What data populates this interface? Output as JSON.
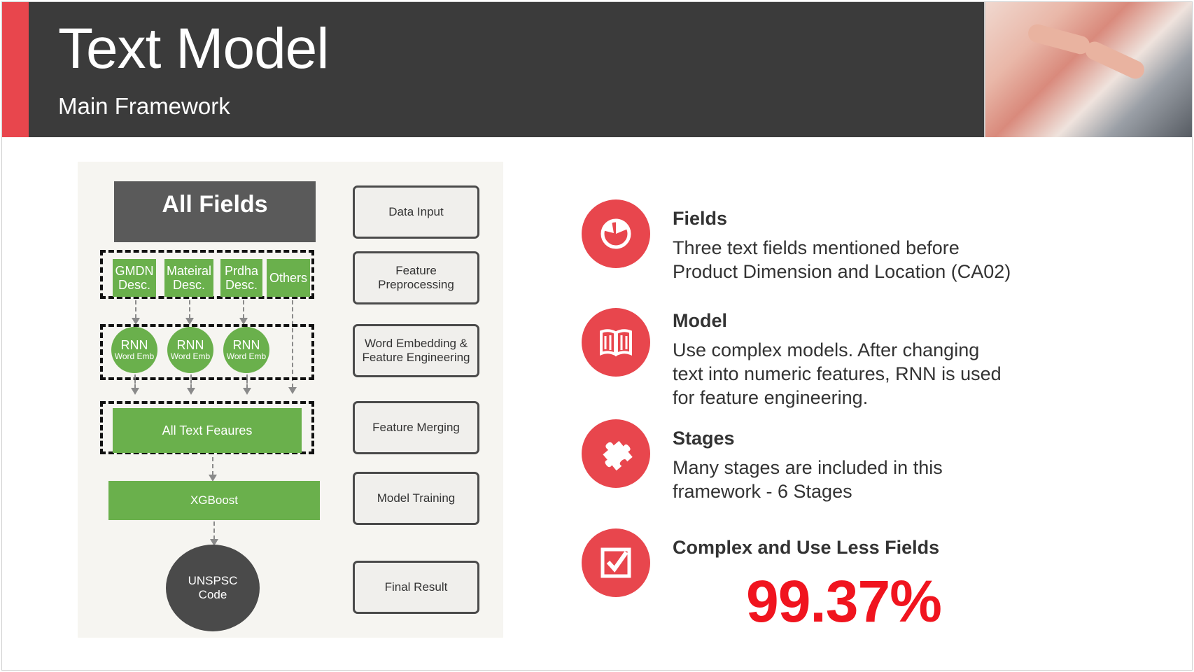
{
  "header": {
    "title": "Text Model",
    "subtitle": "Main Framework"
  },
  "diagram": {
    "all_fields": "All Fields",
    "inputs": [
      {
        "line1": "GMDN",
        "line2": "Desc."
      },
      {
        "line1": "Mateiral",
        "line2": "Desc."
      },
      {
        "line1": "Prdha",
        "line2": "Desc."
      },
      {
        "line1": "Others",
        "line2": ""
      }
    ],
    "rnn": [
      {
        "big": "RNN",
        "small": "Word Emb"
      },
      {
        "big": "RNN",
        "small": "Word Emb"
      },
      {
        "big": "RNN",
        "small": "Word Emb"
      }
    ],
    "all_text": "All Text Feaures",
    "xgboost": "XGBoost",
    "result": {
      "line1": "UNSPSC",
      "line2": "Code"
    },
    "stages": [
      {
        "line1": "Data Input",
        "line2": ""
      },
      {
        "line1": "Feature",
        "line2": "Preprocessing"
      },
      {
        "line1": "Word Embedding &",
        "line2": "Feature Engineering"
      },
      {
        "line1": "Feature Merging",
        "line2": ""
      },
      {
        "line1": "Model Training",
        "line2": ""
      },
      {
        "line1": "Final Result",
        "line2": ""
      }
    ]
  },
  "points": [
    {
      "icon": "pie-chart-icon",
      "title": "Fields",
      "lines": [
        "Three text fields mentioned before",
        "Product Dimension and Location (CA02)"
      ]
    },
    {
      "icon": "book-icon",
      "title": "Model",
      "lines": [
        "Use complex models. After changing",
        "text into numeric features, RNN is used",
        "for feature engineering."
      ]
    },
    {
      "icon": "puzzle-icon",
      "title": "Stages",
      "lines": [
        "Many stages are included in this",
        "framework  - 6 Stages"
      ]
    },
    {
      "icon": "checkbox-icon",
      "title": "Complex and Use Less Fields",
      "lines": []
    }
  ],
  "accuracy": "99.37%",
  "colors": {
    "accent": "#e8464d",
    "header": "#3b3b3b",
    "green": "#6ab04c",
    "percent": "#f0141e"
  }
}
